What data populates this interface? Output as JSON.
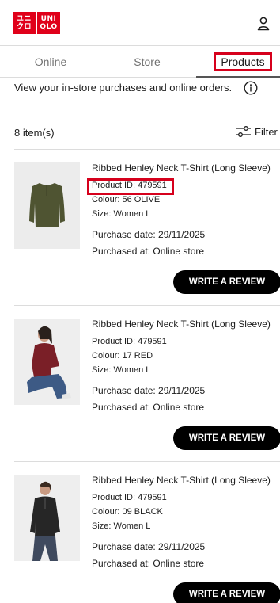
{
  "header": {
    "logo_top": "UNI",
    "logo_bottom": "QLO",
    "user_icon": "user-icon"
  },
  "tabs": [
    {
      "label": "Online"
    },
    {
      "label": "Store"
    },
    {
      "label": "Products"
    }
  ],
  "intro": {
    "text": "View your in-store purchases and online orders.",
    "info_icon": "info-icon"
  },
  "toolbar": {
    "count": "8 item(s)",
    "filter_label": "Filter",
    "filter_icon": "sliders-icon"
  },
  "colors": {
    "brand": "#e0001a",
    "highlight": "#d6001c",
    "button": "#000000",
    "olive": "#4f5432",
    "red": "#7a1f27",
    "black": "#262626"
  },
  "products": [
    {
      "name": "Ribbed Henley Neck T-Shirt (Long Sleeve)",
      "product_id": "Product ID: 479591",
      "colour": "Colour: 56 OLIVE",
      "size": "Size: Women L",
      "purchase_date": "Purchase date: 29/11/2025",
      "purchased_at": "Purchased at: Online store",
      "button": "WRITE A REVIEW"
    },
    {
      "name": "Ribbed Henley Neck T-Shirt (Long Sleeve)",
      "product_id": "Product ID: 479591",
      "colour": "Colour: 17 RED",
      "size": "Size: Women L",
      "purchase_date": "Purchase date: 29/11/2025",
      "purchased_at": "Purchased at: Online store",
      "button": "WRITE A REVIEW"
    },
    {
      "name": "Ribbed Henley Neck T-Shirt (Long Sleeve)",
      "product_id": "Product ID: 479591",
      "colour": "Colour: 09 BLACK",
      "size": "Size: Women L",
      "purchase_date": "Purchase date: 29/11/2025",
      "purchased_at": "Purchased at: Online store",
      "button": "WRITE A REVIEW"
    }
  ]
}
